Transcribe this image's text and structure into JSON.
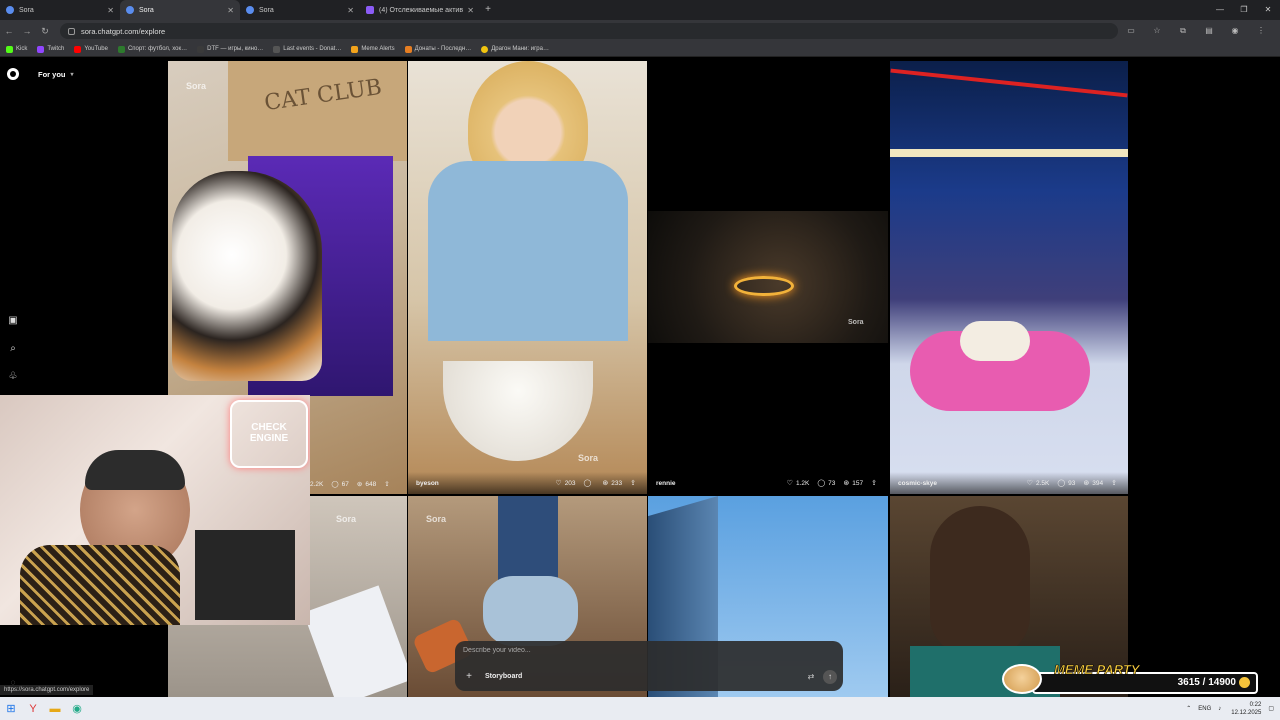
{
  "browser": {
    "tabs": [
      {
        "label": "Sora",
        "active": false,
        "icon": "sora-favicon"
      },
      {
        "label": "Sora",
        "active": true,
        "icon": "sora-favicon"
      },
      {
        "label": "Sora",
        "active": false,
        "icon": "sora-favicon"
      },
      {
        "label": "(4) Отслеживаемые активны…",
        "active": false,
        "icon": "twitch-favicon"
      }
    ],
    "url": "sora.chatgpt.com/explore",
    "status_url": "https://sora.chatgpt.com/explore",
    "bookmarks": [
      {
        "label": "Kick",
        "color": "#53fc18"
      },
      {
        "label": "Twitch",
        "color": "#9146ff"
      },
      {
        "label": "YouTube",
        "color": "#ff0000"
      },
      {
        "label": "Спорт: футбол, хок…",
        "color": "#2d7a2d"
      },
      {
        "label": "DTF — игры, кино…",
        "color": "#3a3a3a"
      },
      {
        "label": "Last events - Donat…",
        "color": "#555555"
      },
      {
        "label": "Meme Alerts",
        "color": "#f2a31b"
      },
      {
        "label": "Донаты - Последн…",
        "color": "#e67e22"
      },
      {
        "label": "Драгон Мани: игра…",
        "color": "#f1c40f"
      }
    ]
  },
  "sidebar": {
    "feed_selector": "For you"
  },
  "tiles": [
    {
      "user": "",
      "likes": "",
      "comments": "67",
      "remixes": "648",
      "partial_likes": "2.2K",
      "watermark": "Sora"
    },
    {
      "user": "byeson",
      "likes": "203",
      "comments": "",
      "remixes": "233",
      "watermark": "Sora"
    },
    {
      "user": "rennie",
      "likes": "1.2K",
      "comments": "73",
      "remixes": "157",
      "watermark": "Sora"
    },
    {
      "user": "cosmic-skye",
      "likes": "2.5K",
      "comments": "93",
      "remixes": "394",
      "watermark": ""
    }
  ],
  "cat_box_text": "CAT CLUB",
  "neon_sign": "CHECK ENGINE",
  "prompt": {
    "placeholder": "Describe your video...",
    "storyboard_label": "Storyboard"
  },
  "overlay": {
    "title": "MEME PARTY",
    "progress": "3615 / 14900"
  },
  "taskbar": {
    "lang": "ENG",
    "time": "0:22",
    "date": "12.12.2025"
  }
}
